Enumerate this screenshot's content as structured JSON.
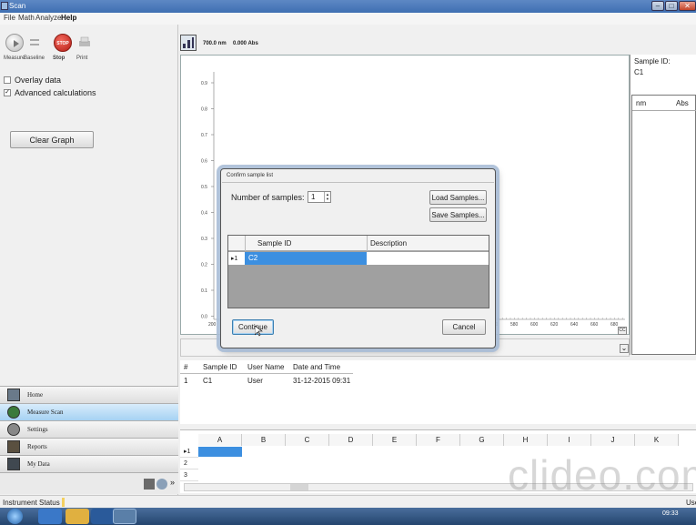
{
  "window": {
    "title": "Scan"
  },
  "menu": [
    "File",
    "Math",
    "Analyze",
    "Help"
  ],
  "toolbar": {
    "measure": "Measure",
    "baseline": "Baseline",
    "stop": "Stop",
    "stop_badge": "STOP",
    "print": "Print"
  },
  "options": {
    "overlay": {
      "label": "Overlay data",
      "checked": false
    },
    "advanced": {
      "label": "Advanced calculations",
      "checked": true
    }
  },
  "clear_graph_label": "Clear Graph",
  "nav": [
    "Home",
    "Measure Scan",
    "Settings",
    "Reports",
    "My Data"
  ],
  "chart_toolbar": {
    "wavelength": "700.0 nm",
    "absorbance": "0.000 Abs"
  },
  "chart_data": {
    "type": "line",
    "y_ticks": [
      "0.9",
      "0.8",
      "0.7",
      "0.6",
      "0.5",
      "0.4",
      "0.3",
      "0.2",
      "0.1",
      "0.0"
    ],
    "x_ticks_visible": [
      "200",
      "560",
      "580",
      "600",
      "620",
      "640",
      "660",
      "680"
    ],
    "series": []
  },
  "side_panel": {
    "sample_id_label": "Sample ID:",
    "sample_id_value": "C1",
    "col_nm": "nm",
    "col_abs": "Abs"
  },
  "results": {
    "headers": [
      "#",
      "Sample ID",
      "User Name",
      "Date and Time"
    ],
    "rows": [
      [
        "1",
        "C1",
        "User",
        "31-12-2015 09:31"
      ]
    ]
  },
  "sheet": {
    "columns": [
      "A",
      "B",
      "C",
      "D",
      "E",
      "F",
      "G",
      "H",
      "I",
      "J",
      "K"
    ],
    "rows": [
      "1",
      "2",
      "3"
    ]
  },
  "status": {
    "instrument": "Instrument Status",
    "right": "Use"
  },
  "watermark": "clideo.com",
  "dialog": {
    "title": "Confirm sample list",
    "num_label": "Number of samples:",
    "num_value": "1",
    "load": "Load Samples...",
    "save": "Save Samples...",
    "col_id": "Sample ID",
    "col_desc": "Description",
    "row_marker": "1",
    "row_id": "C2",
    "continue": "Continue",
    "cancel": "Cancel"
  },
  "tray": {
    "time": "09:33"
  },
  "colors": {
    "accent": "#3c8fe0",
    "stop": "#d8322a",
    "titlebar": "#4a78b8"
  }
}
